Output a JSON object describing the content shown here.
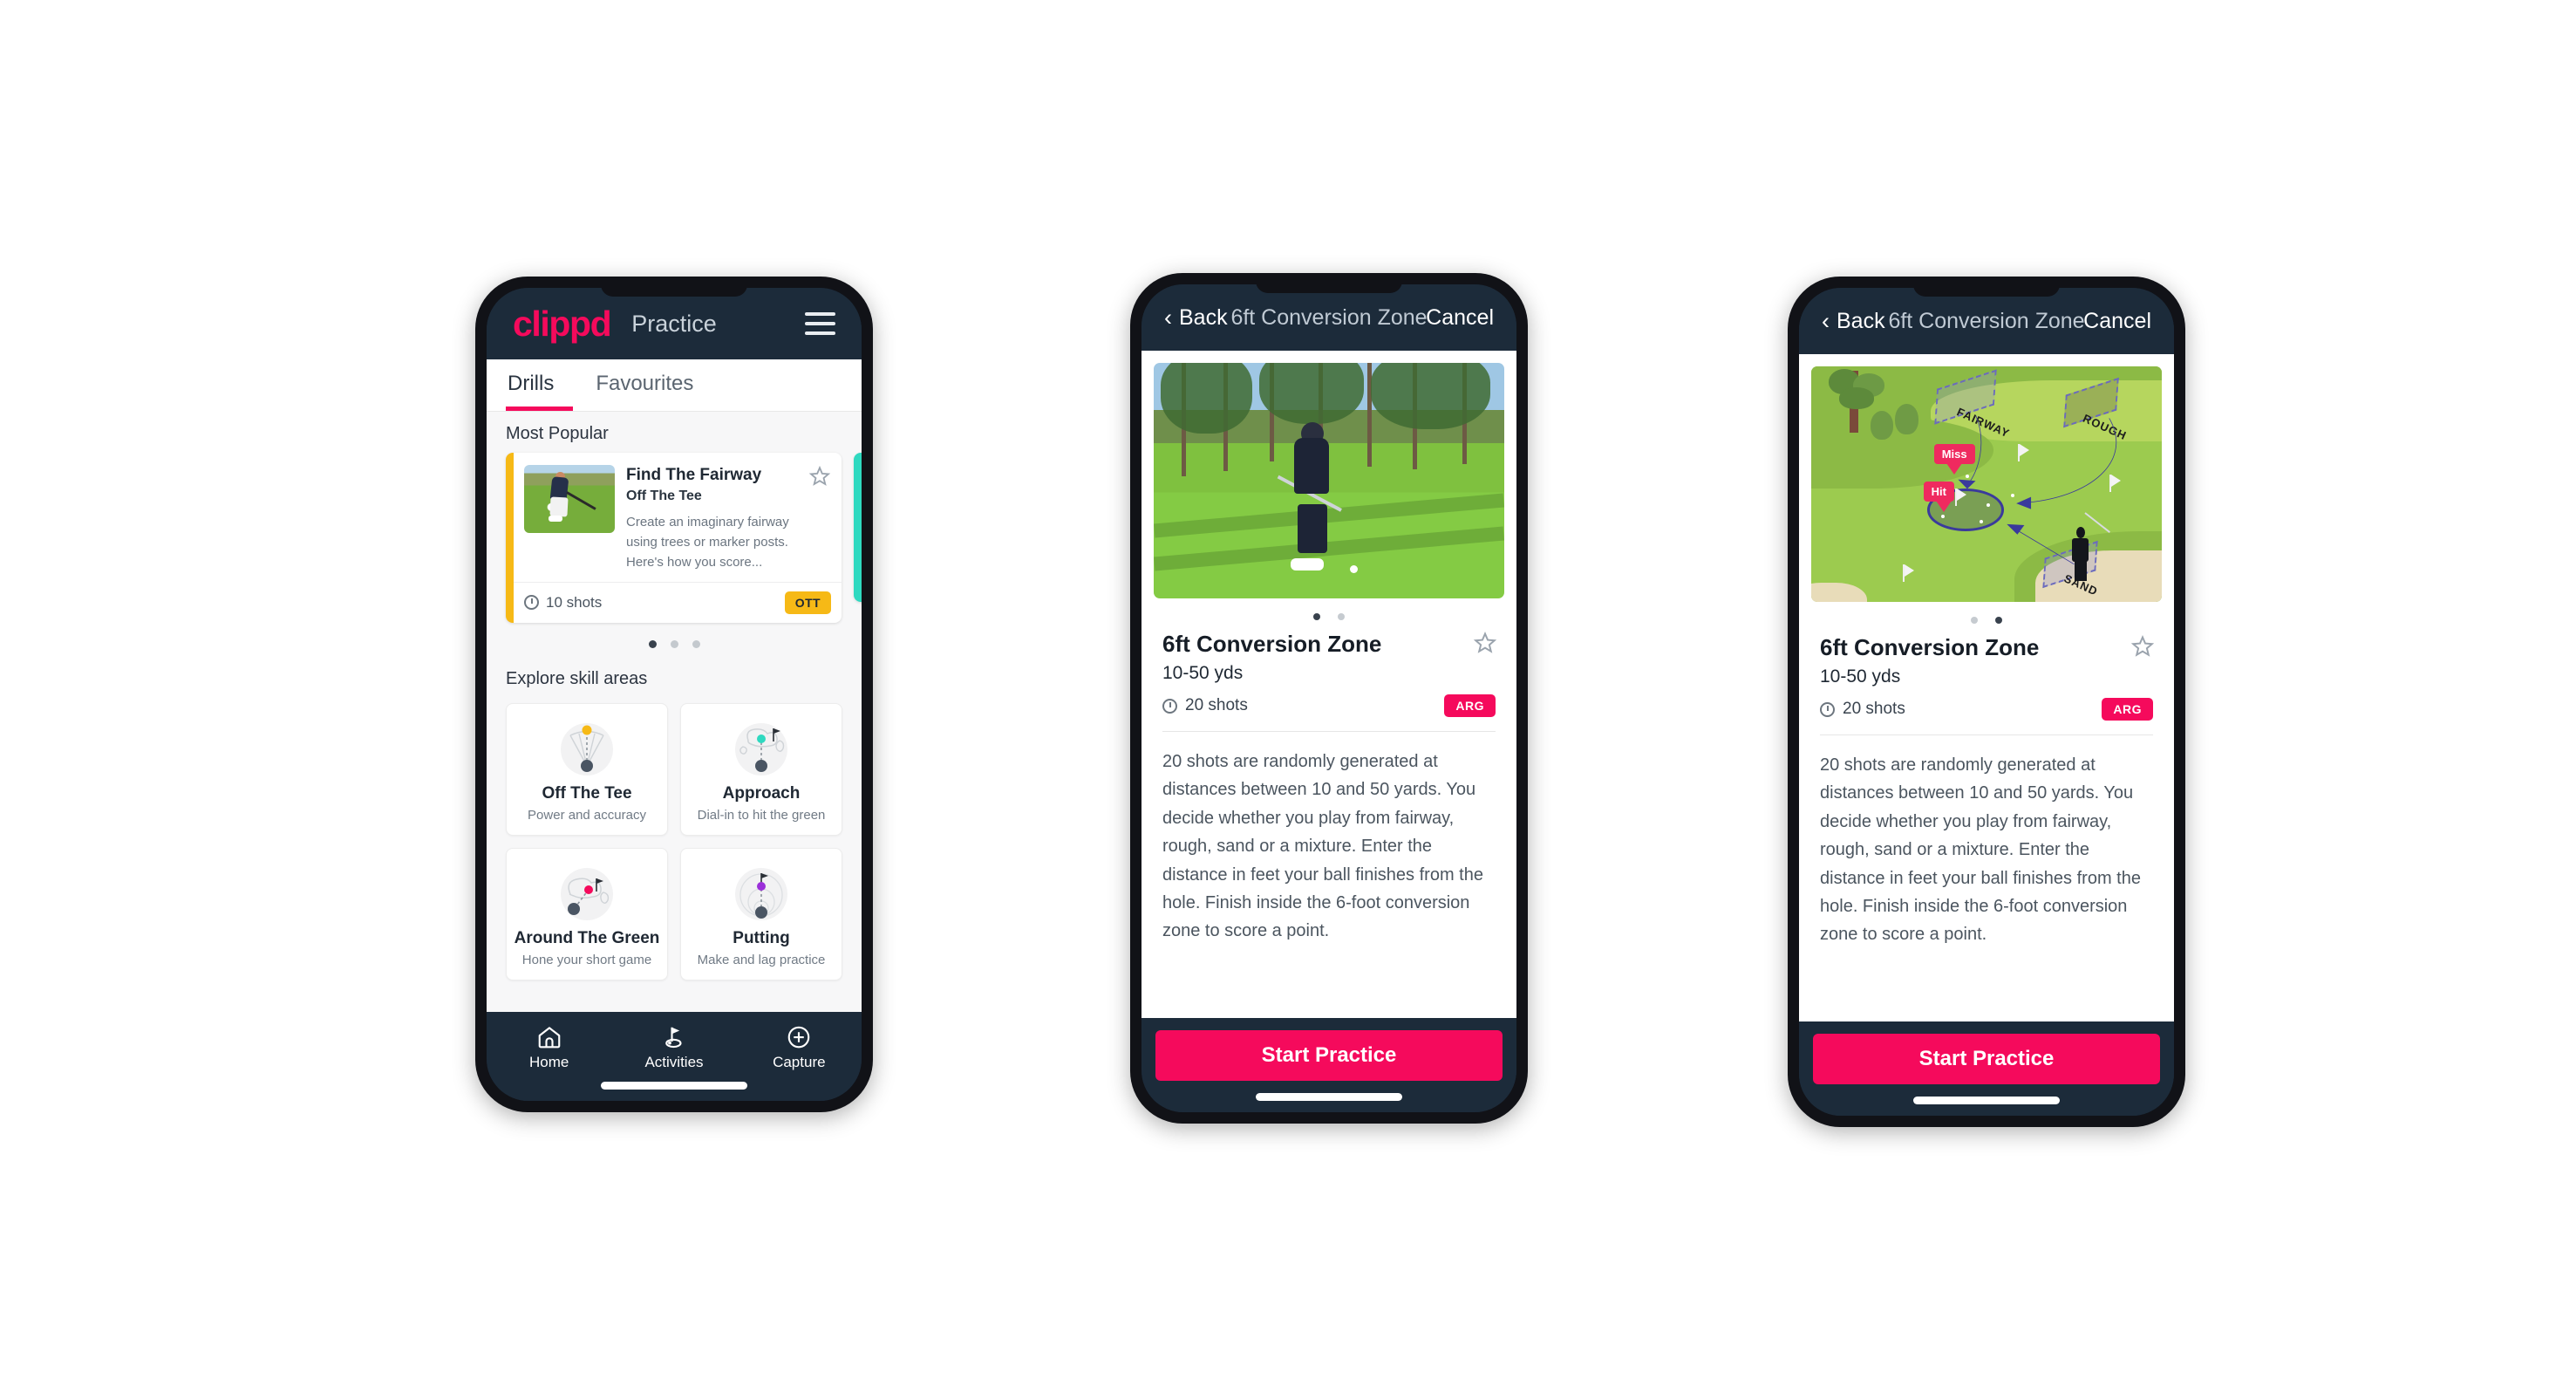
{
  "phone1": {
    "header": {
      "logo": "clippd",
      "title": "Practice",
      "menu_icon": "hamburger-icon"
    },
    "tabs": [
      {
        "label": "Drills",
        "active": true
      },
      {
        "label": "Favourites",
        "active": false
      }
    ],
    "sections": {
      "most_popular_label": "Most Popular",
      "explore_label": "Explore skill areas"
    },
    "drill_card": {
      "title": "Find The Fairway",
      "subtitle": "Off The Tee",
      "description": "Create an imaginary fairway using trees or marker posts. Here's how you score...",
      "shots": "10 shots",
      "badge": "OTT",
      "badge_color": "#f6b916",
      "accent_color": "#f6b916",
      "next_accent_color": "#2fd9c0",
      "favourite_icon": "star-outline-icon"
    },
    "carousel_dots": {
      "count": 3,
      "active_index": 0
    },
    "skills": [
      {
        "name": "Off The Tee",
        "desc": "Power and accuracy",
        "icon": "tee-fan-icon",
        "dot_color": "#f6b916"
      },
      {
        "name": "Approach",
        "desc": "Dial-in to hit the green",
        "icon": "approach-green-icon",
        "dot_color": "#2fd9c0"
      },
      {
        "name": "Around The Green",
        "desc": "Hone your short game",
        "icon": "around-green-icon",
        "dot_color": "#f50a5c"
      },
      {
        "name": "Putting",
        "desc": "Make and lag practice",
        "icon": "putting-rings-icon",
        "dot_color": "#9b30d9"
      }
    ],
    "nav": [
      {
        "label": "Home",
        "icon": "home-icon",
        "active": false
      },
      {
        "label": "Activities",
        "icon": "golf-flag-icon",
        "active": true
      },
      {
        "label": "Capture",
        "icon": "plus-circle-icon",
        "active": false
      }
    ]
  },
  "phone2": {
    "header": {
      "back": "Back",
      "title": "6ft Conversion Zone",
      "cancel": "Cancel",
      "back_icon": "chevron-left-icon"
    },
    "media": {
      "type": "video-still",
      "alt": "golfer-chipping-photo"
    },
    "carousel_dots": {
      "count": 2,
      "active_index": 0
    },
    "detail": {
      "name": "6ft Conversion Zone",
      "yards": "10-50 yds",
      "shots": "20 shots",
      "badge": "ARG",
      "badge_color": "#f50a5c",
      "favourite_icon": "star-outline-icon",
      "description": "20 shots are randomly generated at distances between 10 and 50 yards. You decide whether you play from fairway, rough, sand or a mixture. Enter the distance in feet your ball finishes from the hole. Finish inside the 6-foot conversion zone to score a point."
    },
    "cta": {
      "label": "Start Practice",
      "color": "#f50a5c"
    }
  },
  "phone3": {
    "header": {
      "back": "Back",
      "title": "6ft Conversion Zone",
      "cancel": "Cancel",
      "back_icon": "chevron-left-icon"
    },
    "media": {
      "type": "course-illustration",
      "labels": {
        "fairway": "FAIRWAY",
        "rough": "ROUGH",
        "sand": "SAND"
      },
      "markers": {
        "miss": "Miss",
        "hit": "Hit"
      },
      "marker_color": "#ef2a5f",
      "arrow_color": "#3a3a9c"
    },
    "carousel_dots": {
      "count": 2,
      "active_index": 1
    },
    "detail": {
      "name": "6ft Conversion Zone",
      "yards": "10-50 yds",
      "shots": "20 shots",
      "badge": "ARG",
      "badge_color": "#f50a5c",
      "favourite_icon": "star-outline-icon",
      "description": "20 shots are randomly generated at distances between 10 and 50 yards. You decide whether you play from fairway, rough, sand or a mixture. Enter the distance in feet your ball finishes from the hole. Finish inside the 6-foot conversion zone to score a point."
    },
    "cta": {
      "label": "Start Practice",
      "color": "#f50a5c"
    }
  }
}
